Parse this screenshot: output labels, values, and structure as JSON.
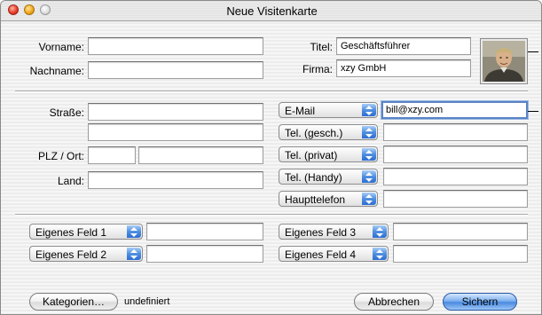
{
  "window": {
    "title": "Neue Visitenkarte"
  },
  "person": {
    "first_name_label": "Vorname:",
    "first_name_value": "",
    "last_name_label": "Nachname:",
    "last_name_value": "",
    "title_label": "Titel:",
    "title_value": "Geschäftsführer",
    "company_label": "Firma:",
    "company_value": "xzy GmbH"
  },
  "address": {
    "street_label": "Straße:",
    "street_value": "",
    "street2_value": "",
    "zip_city_label": "PLZ / Ort:",
    "zip_value": "",
    "city_value": "",
    "country_label": "Land:",
    "country_value": ""
  },
  "contacts": [
    {
      "type": "E-Mail",
      "value": "bill@xzy.com"
    },
    {
      "type": "Tel. (gesch.)",
      "value": ""
    },
    {
      "type": "Tel. (privat)",
      "value": ""
    },
    {
      "type": "Tel. (Handy)",
      "value": ""
    },
    {
      "type": "Haupttelefon",
      "value": ""
    }
  ],
  "custom_fields": [
    {
      "type": "Eigenes Feld 1",
      "value": ""
    },
    {
      "type": "Eigenes Feld 2",
      "value": ""
    },
    {
      "type": "Eigenes Feld 3",
      "value": ""
    },
    {
      "type": "Eigenes Feld 4",
      "value": ""
    }
  ],
  "footer": {
    "categories_label": "Kategorien…",
    "category_value": "undefiniert",
    "cancel_label": "Abbrechen",
    "save_label": "Sichern"
  },
  "colors": {
    "accent": "#4a8ae0",
    "focus_ring": "#5b84c4"
  },
  "icons": {
    "popup_arrow": "updown-arrows-icon",
    "photo": "person-photo"
  }
}
